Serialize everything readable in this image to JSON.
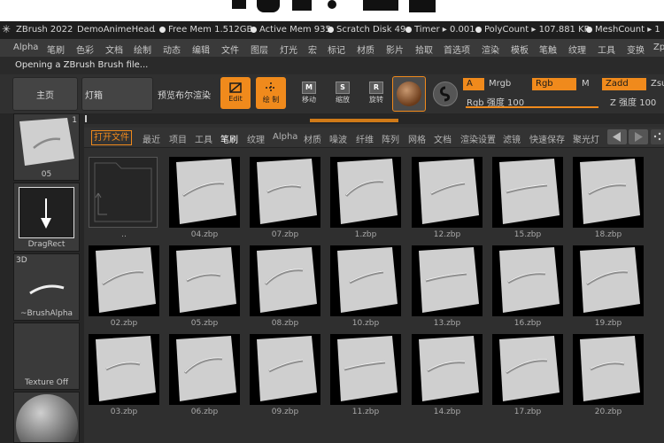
{
  "status_bar": {
    "app": "ZBrush 2022",
    "project": "DemoAnimeHead",
    "sep": ".",
    "free_mem": "Free Mem 1.512GB",
    "active_mem": "Active Mem 935",
    "scratch_disk": "Scratch Disk 49",
    "timer": "Timer ▸ 0.001",
    "polycount": "PolyCount ▸ 107.881 KP",
    "meshcount": "MeshCount ▸ 1"
  },
  "menu": [
    "Alpha",
    "笔刷",
    "色彩",
    "文档",
    "绘制",
    "动态",
    "编辑",
    "文件",
    "图层",
    "灯光",
    "宏",
    "标记",
    "材质",
    "影片",
    "拾取",
    "首选项",
    "渲染",
    "模板",
    "笔触",
    "纹理",
    "工具",
    "变换",
    "Zp"
  ],
  "message": "Opening a ZBrush Brush file...",
  "toolbar": {
    "home": "主页",
    "lightbox": "灯箱",
    "boolean": "预览布尔渲染",
    "edit": "Edit",
    "draw": "绘 制",
    "move": "移动",
    "scale": "缩放",
    "rotate": "旋转",
    "a_label": "A",
    "mrgb": "Mrgb",
    "rgb": "Rgb",
    "m_label": "M",
    "zadd": "Zadd",
    "zsub": "Zsu",
    "rgb_intensity": "Rgb 强度 100",
    "z_intensity": "Z 强度 100"
  },
  "left_panel": [
    {
      "label": "05",
      "badge": "1"
    },
    {
      "label": "DragRect"
    },
    {
      "label": "~BrushAlpha",
      "badge": "3D"
    },
    {
      "label": "Texture Off"
    }
  ],
  "tabs": [
    "打开文件",
    "最近",
    "项目",
    "工具",
    "笔刷",
    "纹理",
    "Alpha",
    "材质",
    "噪波",
    "纤维",
    "阵列",
    "网格",
    "文档",
    "渲染设置",
    "滤镜",
    "快速保存",
    "聚光灯"
  ],
  "active_tab": "笔刷",
  "files": [
    {
      "name": ".."
    },
    {
      "name": "04.zbp"
    },
    {
      "name": "07.zbp"
    },
    {
      "name": "1.zbp"
    },
    {
      "name": "12.zbp"
    },
    {
      "name": "15.zbp"
    },
    {
      "name": "18.zbp"
    },
    {
      "name": "02.zbp"
    },
    {
      "name": "05.zbp"
    },
    {
      "name": "08.zbp"
    },
    {
      "name": "10.zbp"
    },
    {
      "name": "13.zbp"
    },
    {
      "name": "16.zbp"
    },
    {
      "name": "19.zbp"
    },
    {
      "name": "03.zbp"
    },
    {
      "name": "06.zbp"
    },
    {
      "name": "09.zbp"
    },
    {
      "name": "11.zbp"
    },
    {
      "name": "14.zbp"
    },
    {
      "name": "17.zbp"
    },
    {
      "name": "20.zbp"
    }
  ],
  "colors": {
    "accent": "#f08a1c",
    "thumb_card": "#cfcfcf",
    "thumb_bg": "#000000"
  }
}
